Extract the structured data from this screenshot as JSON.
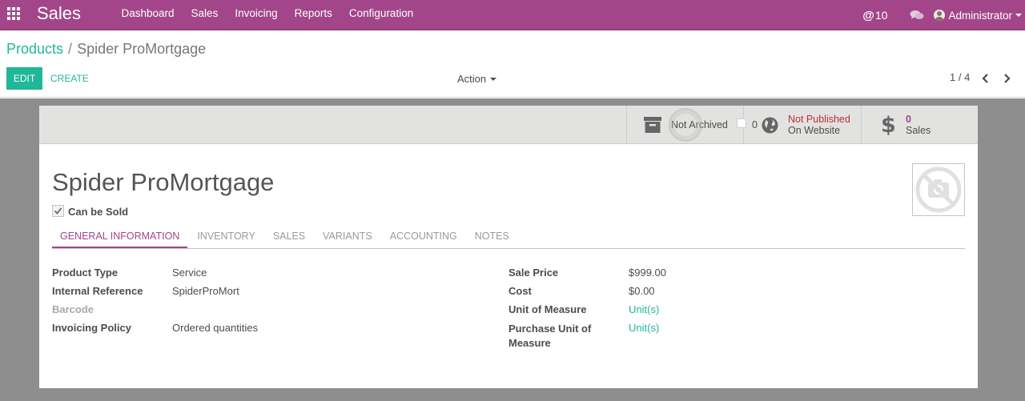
{
  "navbar": {
    "app_name": "Sales",
    "menu": [
      "Dashboard",
      "Sales",
      "Invoicing",
      "Reports",
      "Configuration"
    ],
    "messages_count": "10",
    "user_name": "Administrator"
  },
  "control_panel": {
    "breadcrumb_parent": "Products",
    "breadcrumb_separator": "/",
    "breadcrumb_current": "Spider ProMortgage",
    "edit_label": "EDIT",
    "create_label": "CREATE",
    "action_label": "Action",
    "pager": "1 / 4"
  },
  "stat_buttons": {
    "archive_label": "Not Archived",
    "web_count": "0",
    "web_status": "Not Published",
    "web_sub": "On Website",
    "sales_count": "0",
    "sales_label": "Sales"
  },
  "product": {
    "name": "Spider ProMortgage",
    "can_be_sold_label": "Can be Sold",
    "can_be_sold": true
  },
  "tabs": [
    "GENERAL INFORMATION",
    "INVENTORY",
    "SALES",
    "VARIANTS",
    "ACCOUNTING",
    "NOTES"
  ],
  "fields_left": [
    {
      "label": "Product Type",
      "value": "Service"
    },
    {
      "label": "Internal Reference",
      "value": "SpiderProMort"
    },
    {
      "label": "Barcode",
      "value": ""
    },
    {
      "label": "Invoicing Policy",
      "value": "Ordered quantities"
    }
  ],
  "fields_right": [
    {
      "label": "Sale Price",
      "value": "$999.00"
    },
    {
      "label": "Cost",
      "value": "$0.00"
    },
    {
      "label": "Unit of Measure",
      "value": "Unit(s)"
    },
    {
      "label": "Purchase Unit of Measure",
      "value": "Unit(s)"
    }
  ],
  "colors": {
    "brand": "#a24689",
    "accent": "#21b799",
    "unpublished": "#b73232"
  },
  "icons": [
    "apps-grid-icon",
    "at-icon",
    "chat-icon",
    "caret-down-icon",
    "archive-icon",
    "globe-icon",
    "dollar-icon",
    "camera-slash-icon",
    "chevron-left-icon",
    "chevron-right-icon",
    "checkmark-icon"
  ]
}
